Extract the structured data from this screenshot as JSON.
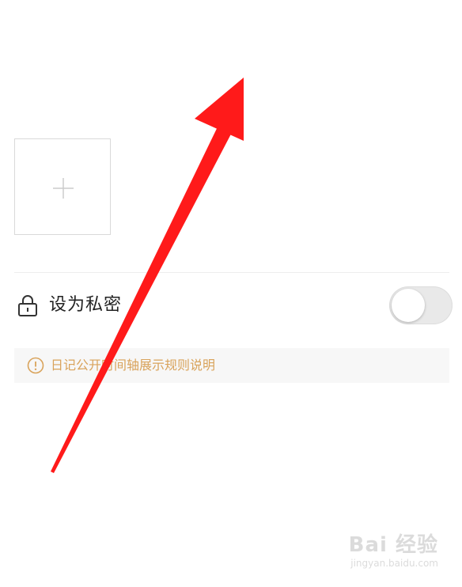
{
  "settings": {
    "private_label": "设为私密",
    "private_enabled": false
  },
  "info": {
    "text": "日记公开时间轴展示规则说明"
  },
  "icons": {
    "add": "plus-icon",
    "lock": "lock-icon",
    "info": "info-icon"
  },
  "colors": {
    "info_text": "#d9a35b",
    "arrow": "#ff1a1a",
    "toggle_track": "#e9e9e9"
  },
  "watermark": {
    "logo": "Bai 经验",
    "url": "jingyan.baidu.com"
  }
}
